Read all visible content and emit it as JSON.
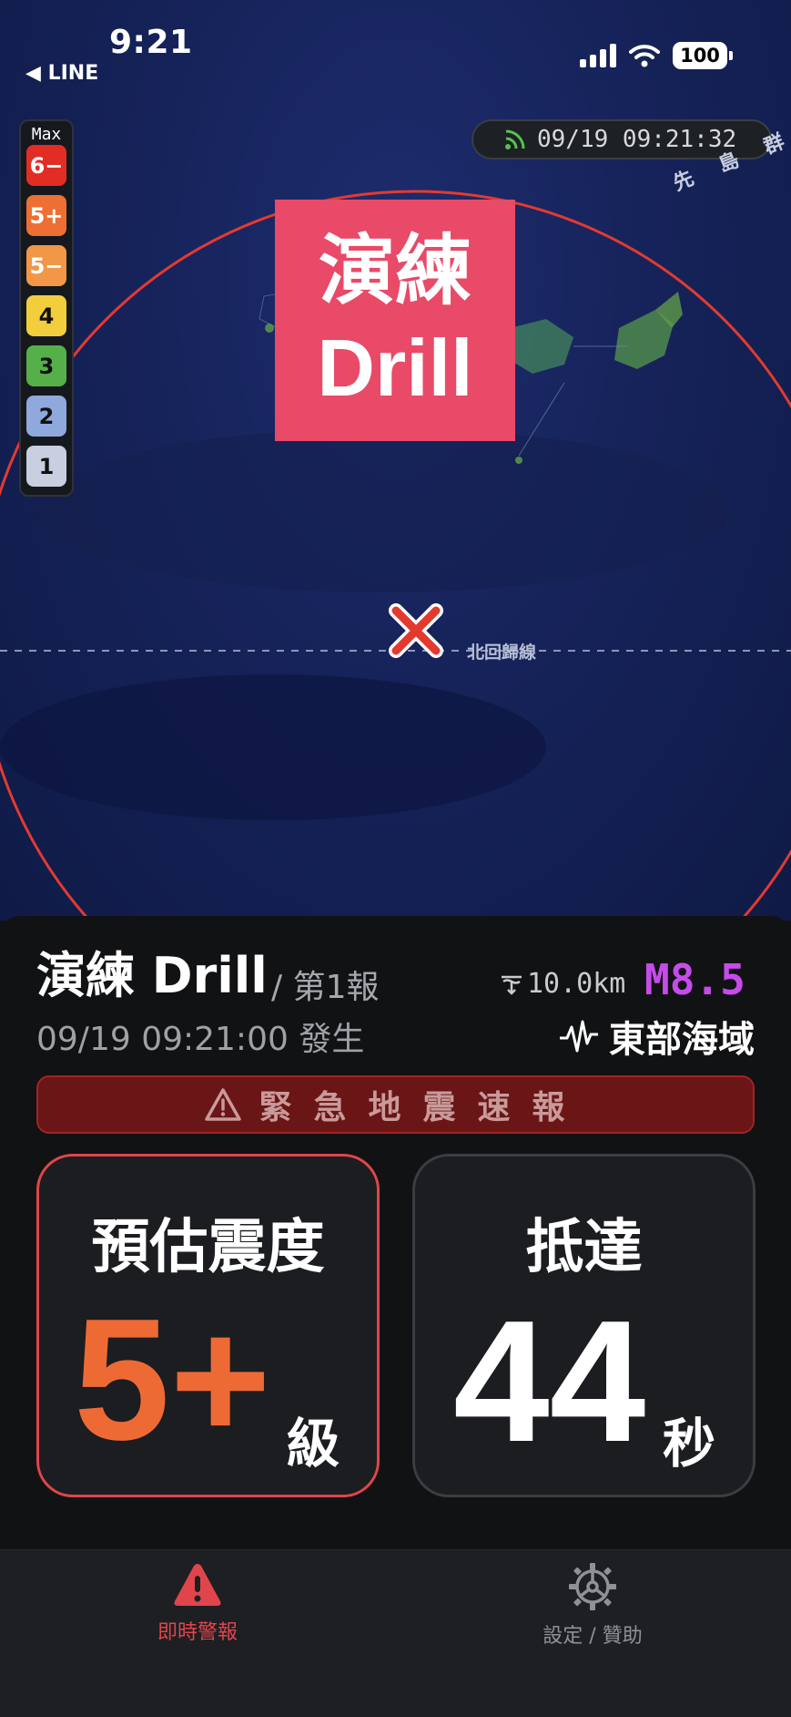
{
  "status_bar": {
    "time": "9:21",
    "back_label": "◀ LINE",
    "battery": "100"
  },
  "map": {
    "intensity_scale": {
      "title": "Max",
      "levels": [
        {
          "label": "6−",
          "color": "#e22d24",
          "text_color": "#ffffff"
        },
        {
          "label": "5+",
          "color": "#ee6f33",
          "text_color": "#ffffff"
        },
        {
          "label": "5−",
          "color": "#f19747",
          "text_color": "#ffffff"
        },
        {
          "label": "4",
          "color": "#f2cd3c",
          "text_color": "#111111"
        },
        {
          "label": "3",
          "color": "#55b04a",
          "text_color": "#111111"
        },
        {
          "label": "2",
          "color": "#8fa9dc",
          "text_color": "#111111"
        },
        {
          "label": "1",
          "color": "#c9cee0",
          "text_color": "#111111"
        }
      ]
    },
    "timestamp": "09/19 09:21:32",
    "drill_stamp": {
      "line1": "演練",
      "line2": "Drill"
    },
    "island_label": "先 島 群 島",
    "tropic_label": "北回歸線",
    "colors": {
      "circle": "#e33a30",
      "epicenter": "#e23a2f"
    }
  },
  "event": {
    "title": "演練 Drill",
    "report": "/ 第1報",
    "occurred": "09/19 09:21:00 發生",
    "depth": "10.0km",
    "magnitude": "M8.5",
    "region": "東部海域",
    "alert_text": "緊急地震速報"
  },
  "cards": {
    "intensity": {
      "label": "預估震度",
      "value": "5+",
      "unit": "級",
      "color": "#ee6a35"
    },
    "arrival": {
      "label": "抵達",
      "value": "44",
      "unit": "秒"
    }
  },
  "tabs": [
    {
      "label": "即時警報",
      "icon": "warning-icon",
      "active": true,
      "color": "#e0454b"
    },
    {
      "label": "設定 / 贊助",
      "icon": "gear-icon",
      "active": false,
      "color": "#8e9196"
    }
  ]
}
